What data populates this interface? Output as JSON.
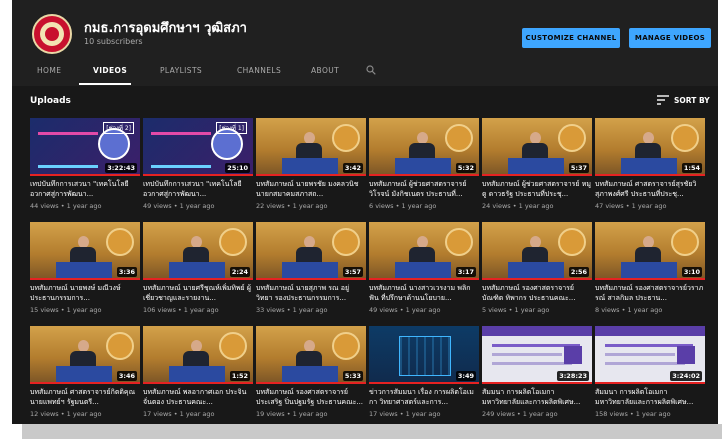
{
  "channel": {
    "name": "กมธ.การอุดมศึกษาฯ วุฒิสภา",
    "subscribers": "10 subscribers"
  },
  "buttons": {
    "customize": "CUSTOMIZE CHANNEL",
    "manage": "MANAGE VIDEOS"
  },
  "tabs": [
    "HOME",
    "VIDEOS",
    "PLAYLISTS",
    "CHANNELS",
    "ABOUT"
  ],
  "active_tab": "VIDEOS",
  "section": {
    "title": "Uploads",
    "sort": "SORT BY"
  },
  "colors": {
    "background": "#181818",
    "accent": "#3ea6ff",
    "progress": "#e52222"
  },
  "videos": [
    {
      "title": "เทปบันทึกการเสวนา \"เทคโนโลยีอวกาศสู่การพัฒนา...",
      "views": "44 views",
      "age": "1 year ago",
      "duration": "3:22:43",
      "thumb": "poster",
      "tag": "[ช่วงที่ 2]"
    },
    {
      "title": "เทปบันทึกการเสวนา \"เทคโนโลยีอวกาศสู่การพัฒนา...",
      "views": "49 views",
      "age": "1 year ago",
      "duration": "25:10",
      "thumb": "poster",
      "tag": "[ช่วงที่ 1]"
    },
    {
      "title": "บทสัมภาษณ์ นายพรชัย มงคลวนิช นายกสมาคมสภาสถ...",
      "views": "22 views",
      "age": "1 year ago",
      "duration": "3:42",
      "thumb": "stage"
    },
    {
      "title": "บทสัมภาษณ์ ผู้ช่วยศาสตราจารย์วิโรจน์ มังกิชเนตร ประธานที่...",
      "views": "6 views",
      "age": "1 year ago",
      "duration": "5:32",
      "thumb": "stage"
    },
    {
      "title": "บทสัมภาษณ์ ผู้ช่วยศาสตราจารย์ หมูดู ดาวธรัฐ ประธานที่ประชุ...",
      "views": "24 views",
      "age": "1 year ago",
      "duration": "5:37",
      "thumb": "stage"
    },
    {
      "title": "บทสัมภาษณ์ ศาสตราจารย์สุรชัยวิ สุภาพงศ์ศรี ประธานที่ประชุ...",
      "views": "47 views",
      "age": "1 year ago",
      "duration": "1:54",
      "thumb": "stage"
    },
    {
      "title": "บทสัมภาษณ์ นายพงษ์ มณีวงษ์ ประธานกรรมการ...",
      "views": "15 views",
      "age": "1 year ago",
      "duration": "3:36",
      "thumb": "stage"
    },
    {
      "title": "บทสัมภาษณ์ นายศรีชุณห์เพิ่มทิพย์ ผู้เชี่ยวชาญและรายงาน...",
      "views": "106 views",
      "age": "1 year ago",
      "duration": "2:24",
      "thumb": "stage"
    },
    {
      "title": "บทสัมภาษณ์ นายสุภาพ รณ อยู่ วิทยา รองประธานกรรมการ...",
      "views": "33 views",
      "age": "1 year ago",
      "duration": "3:57",
      "thumb": "stage"
    },
    {
      "title": "บทสัมภาษณ์ นางสาวเวรงาม พลิกฟัน ที่ปรึกษาด้านนโยบาย...",
      "views": "49 views",
      "age": "1 year ago",
      "duration": "3:17",
      "thumb": "stage"
    },
    {
      "title": "บทสัมภาษณ์ รองศาสตราจารย์ บัณฑิต ทิพากร ประธานคณะ...",
      "views": "5 views",
      "age": "1 year ago",
      "duration": "2:56",
      "thumb": "stage"
    },
    {
      "title": "บทสัมภาษณ์ รองศาสตราจารย์วราภรณ์ สาลกิมล ประธาน...",
      "views": "8 views",
      "age": "1 year ago",
      "duration": "3:10",
      "thumb": "stage"
    },
    {
      "title": "บทสัมภาษณ์ ศาสตราจารย์กิตติคุณ นายแพทย์ฯ รัฐมนตรี...",
      "views": "12 views",
      "age": "1 year ago",
      "duration": "3:46",
      "thumb": "stage"
    },
    {
      "title": "บทสัมภาษณ์ พลอากาศเอก ประจิน จั่นตอง ประธานคณะ...",
      "views": "17 views",
      "age": "1 year ago",
      "duration": "1:52",
      "thumb": "stage"
    },
    {
      "title": "บทสัมภาษณ์ รองศาสตราจารย์ประเสริฐ ปิ่นปฐมรัฐ ประธานคณะ...",
      "views": "19 views",
      "age": "1 year ago",
      "duration": "5:33",
      "thumb": "stage"
    },
    {
      "title": "ข่าวการสัมมนา เรื่อง การผลิตโอเมกา วิทยาศาสตร์และการ...",
      "views": "17 views",
      "age": "1 year ago",
      "duration": "3:49",
      "thumb": "tech"
    },
    {
      "title": "สัมมนา การผลิตโอเมกา มหาวิทยาลัยและการผลิตพิเศษ...",
      "views": "249 views",
      "age": "1 year ago",
      "duration": "3:28:23",
      "thumb": "doc"
    },
    {
      "title": "สัมมนา การผลิตโอเมกา มหาวิทยาลัยและการผลิตพิเศษ...",
      "views": "158 views",
      "age": "1 year ago",
      "duration": "3:24:02",
      "thumb": "doc"
    }
  ]
}
